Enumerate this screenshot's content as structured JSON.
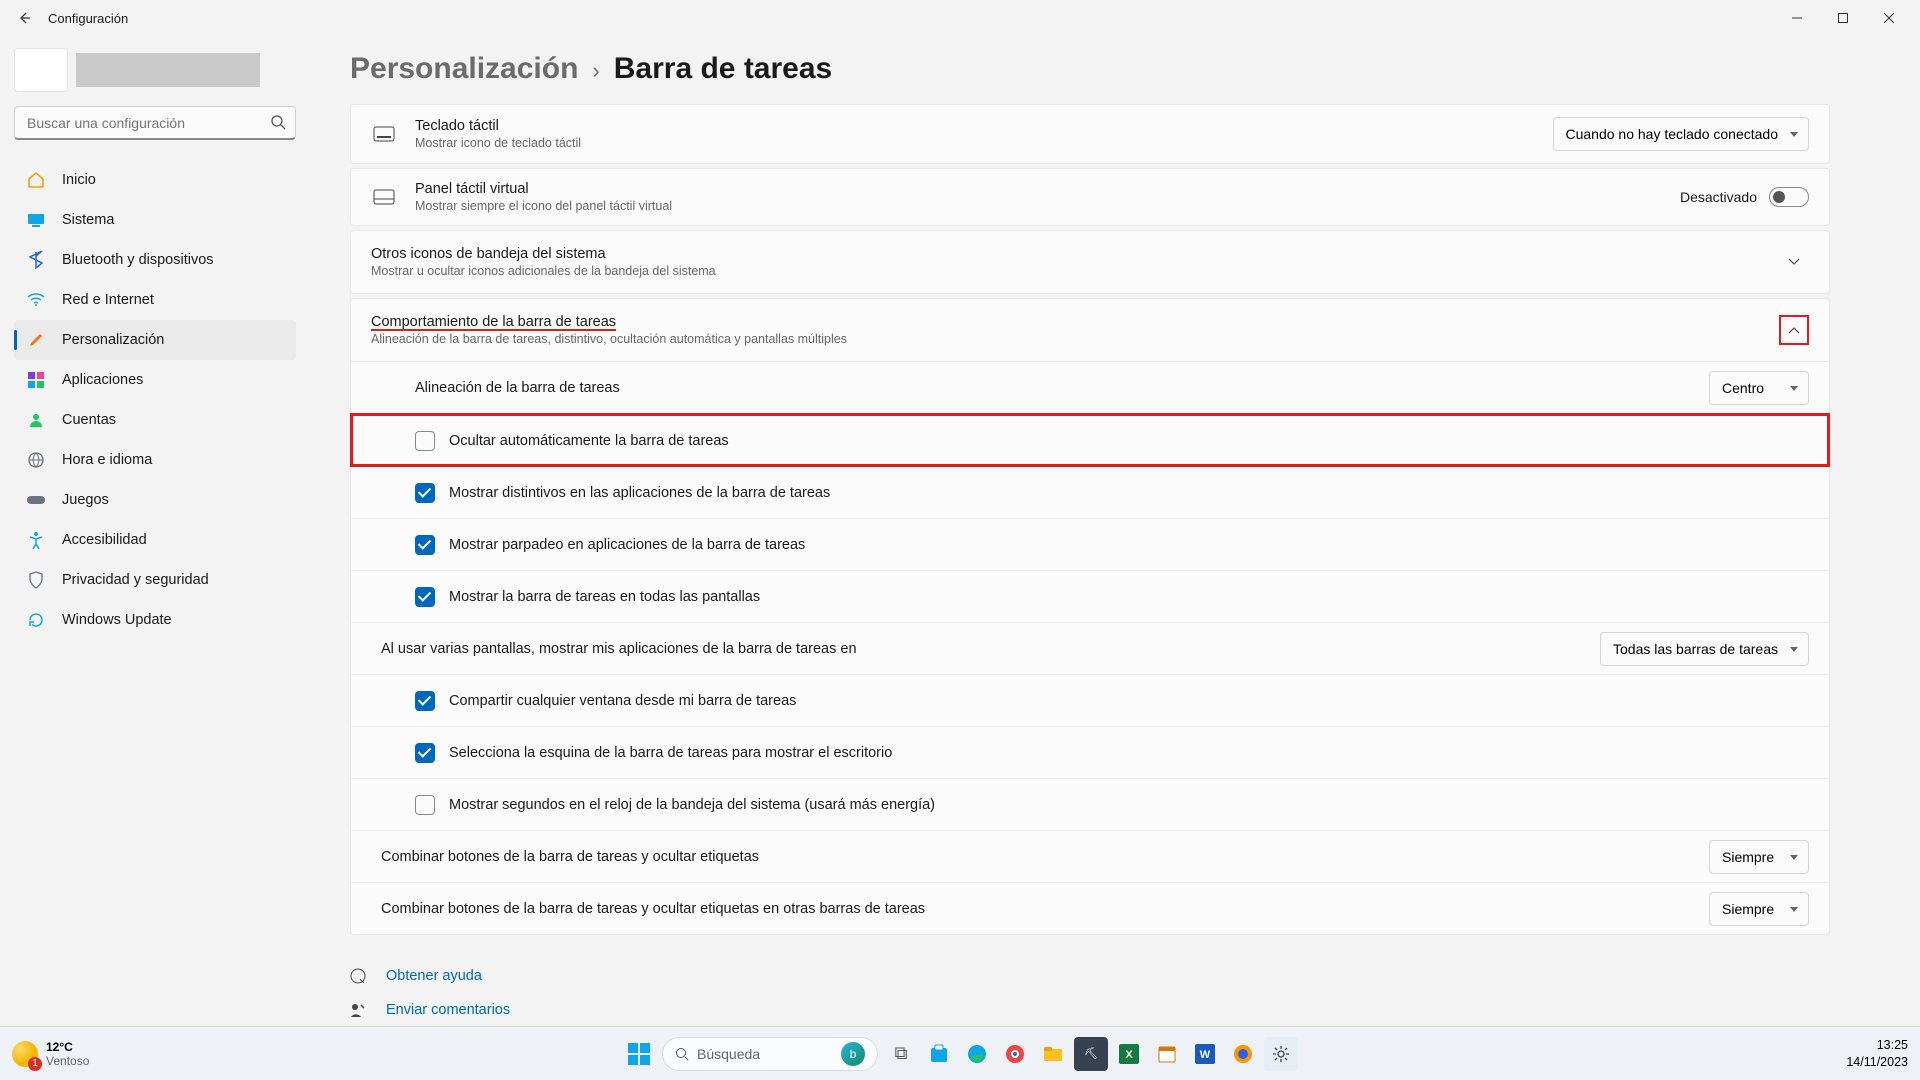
{
  "window": {
    "app_title": "Configuración"
  },
  "search": {
    "placeholder": "Buscar una configuración"
  },
  "sidebar": {
    "items": [
      {
        "label": "Inicio",
        "icon": "home",
        "color": "#f59e0b"
      },
      {
        "label": "Sistema",
        "icon": "system",
        "color": "#0ea5e9"
      },
      {
        "label": "Bluetooth y dispositivos",
        "icon": "bluetooth",
        "color": "#2563eb"
      },
      {
        "label": "Red e Internet",
        "icon": "wifi",
        "color": "#0ea5e9"
      },
      {
        "label": "Personalización",
        "icon": "brush",
        "color": "#f97316",
        "active": true
      },
      {
        "label": "Aplicaciones",
        "icon": "apps",
        "color": "#6b7280"
      },
      {
        "label": "Cuentas",
        "icon": "user",
        "color": "#22c55e"
      },
      {
        "label": "Hora e idioma",
        "icon": "globe",
        "color": "#6b7280"
      },
      {
        "label": "Juegos",
        "icon": "gamepad",
        "color": "#6b7280"
      },
      {
        "label": "Accesibilidad",
        "icon": "accessibility",
        "color": "#0ea5e9"
      },
      {
        "label": "Privacidad y seguridad",
        "icon": "shield",
        "color": "#6b7280"
      },
      {
        "label": "Windows Update",
        "icon": "update",
        "color": "#0ea5e9"
      }
    ]
  },
  "breadcrumb": {
    "parent": "Personalización",
    "sep": "›",
    "current": "Barra de tareas"
  },
  "cards": {
    "touch_keyboard": {
      "title": "Teclado táctil",
      "sub": "Mostrar icono de teclado táctil",
      "dropdown": "Cuando no hay teclado conectado"
    },
    "virtual_touchpad": {
      "title": "Panel táctil virtual",
      "sub": "Mostrar siempre el icono del panel táctil virtual",
      "toggle_label": "Desactivado"
    },
    "other_tray": {
      "title": "Otros iconos de bandeja del sistema",
      "sub": "Mostrar u ocultar iconos adicionales de la bandeja del sistema"
    },
    "behavior": {
      "title": "Comportamiento de la barra de tareas",
      "sub": "Alineación de la barra de tareas, distintivo, ocultación automática y pantallas múltiples"
    }
  },
  "behavior_options": {
    "alignment": {
      "label": "Alineación de la barra de tareas",
      "value": "Centro"
    },
    "auto_hide": {
      "label": "Ocultar automáticamente la barra de tareas",
      "checked": false,
      "highlight": true
    },
    "badges": {
      "label": "Mostrar distintivos en las aplicaciones de la barra de tareas",
      "checked": true
    },
    "flash": {
      "label": "Mostrar parpadeo en aplicaciones de la barra de tareas",
      "checked": true
    },
    "all_displays": {
      "label": "Mostrar la barra de tareas en todas las pantallas",
      "checked": true
    },
    "multi_displays": {
      "label": "Al usar varias pantallas, mostrar mis aplicaciones de la barra de tareas en",
      "value": "Todas las barras de tareas"
    },
    "share_window": {
      "label": "Compartir cualquier ventana desde mi barra de tareas",
      "checked": true
    },
    "corner_desktop": {
      "label": "Selecciona la esquina de la barra de tareas para mostrar el escritorio",
      "checked": true
    },
    "seconds": {
      "label": "Mostrar segundos en el reloj de la bandeja del sistema (usará más energía)",
      "checked": false
    },
    "combine_main": {
      "label": "Combinar botones de la barra de tareas y ocultar etiquetas",
      "value": "Siempre"
    },
    "combine_other": {
      "label": "Combinar botones de la barra de tareas y ocultar etiquetas en otras barras de tareas",
      "value": "Siempre"
    }
  },
  "links": {
    "help": "Obtener ayuda",
    "feedback": "Enviar comentarios"
  },
  "taskbar": {
    "weather": {
      "temp": "12°C",
      "cond": "Ventoso"
    },
    "search_placeholder": "Búsqueda",
    "time": "13:25",
    "date": "14/11/2023"
  }
}
